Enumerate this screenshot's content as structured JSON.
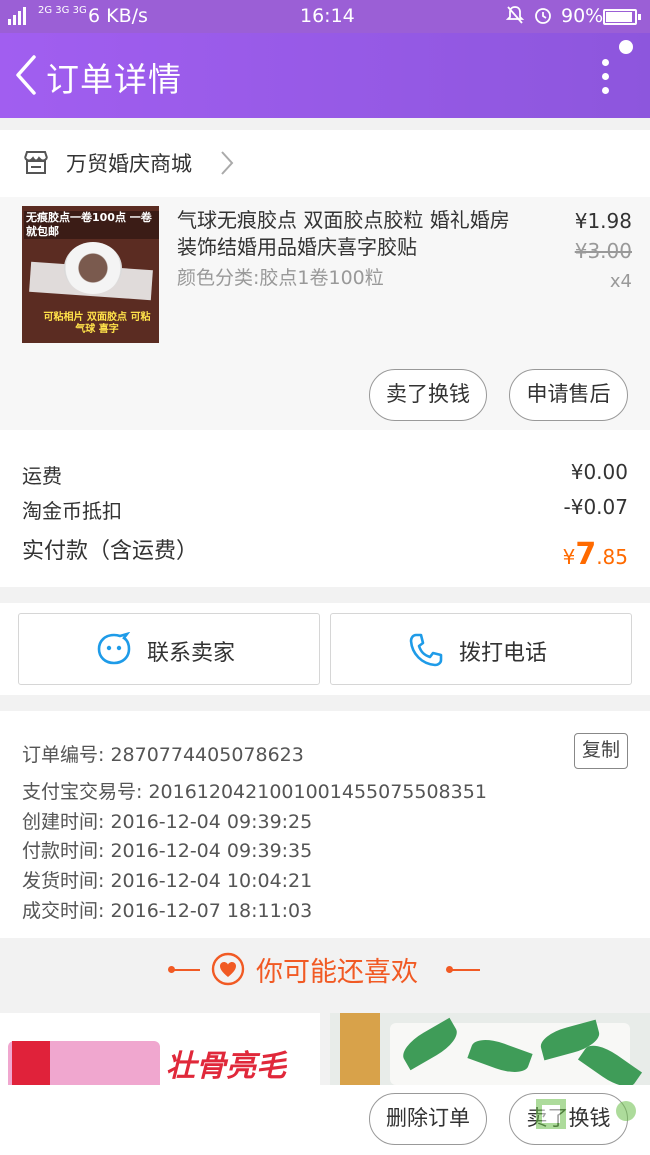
{
  "status_bar": {
    "network": "2G 3G 3G",
    "speed": "6 KB/s",
    "time": "16:14",
    "battery": "90%"
  },
  "header": {
    "title": "订单详情"
  },
  "shop": {
    "name": "万贸婚庆商城"
  },
  "product": {
    "title": "气球无痕胶点 双面胶点胶粒 婚礼婚房装饰结婚用品婚庆喜字胶贴",
    "spec": "颜色分类:胶点1卷100粒",
    "price": "¥1.98",
    "original_price": "¥3.00",
    "quantity": "x4",
    "image_text_top": "无痕胶点一卷100点 一卷就包邮",
    "image_text_bottom": "可粘相片 双面胶点 可粘气球 喜字"
  },
  "product_actions": {
    "sell_label": "卖了换钱",
    "after_sale_label": "申请售后"
  },
  "fees": {
    "shipping_label": "运费",
    "shipping_value": "¥0.00",
    "coin_label": "淘金币抵扣",
    "coin_value": "-¥0.07",
    "total_label": "实付款（含运费）",
    "total_currency": "¥",
    "total_int": "7",
    "total_dec": ".85"
  },
  "contact": {
    "seller_label": "联系卖家",
    "call_label": "拨打电话"
  },
  "order_info": {
    "order_no": "订单编号: 2870774405078623",
    "alipay_no": "支付宝交易号: 2016120421001001455075508351",
    "created": "创建时间: 2016-12-04 09:39:25",
    "paid": "付款时间: 2016-12-04 09:39:35",
    "shipped": "发货时间: 2016-12-04 10:04:21",
    "completed": "成交时间: 2016-12-07 18:11:03",
    "copy_label": "复制"
  },
  "recommend": {
    "title": "你可能还喜欢",
    "card1_text": "壮骨亮毛"
  },
  "bottom_bar": {
    "delete_label": "删除订单",
    "sell_label": "卖了换钱"
  },
  "colors": {
    "header_purple": "#9b5fd6",
    "accent_orange": "#ff6a00",
    "recommend_red": "#f15a24",
    "icon_blue": "#1e9be8"
  }
}
